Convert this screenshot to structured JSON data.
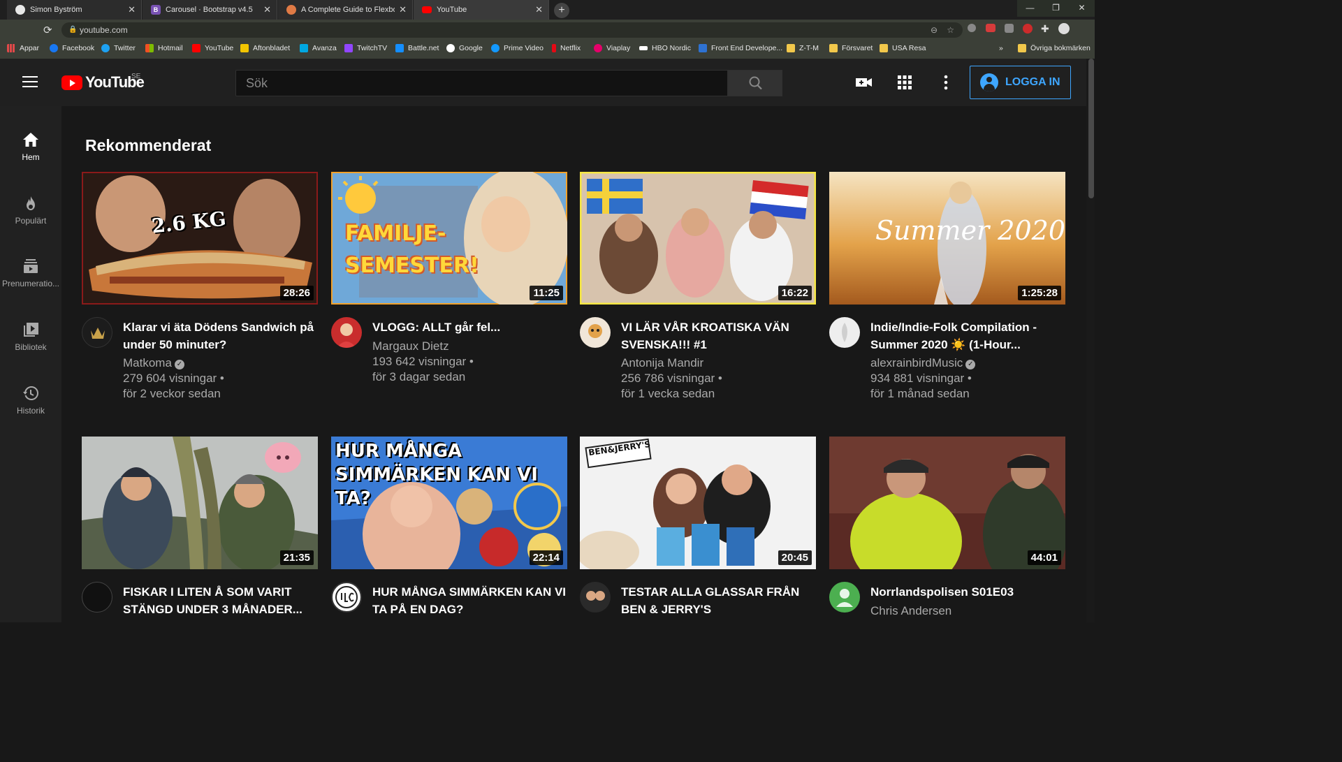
{
  "browser": {
    "tabs": [
      {
        "label": "Simon Byström",
        "icon_color": "#e8e8e8"
      },
      {
        "label": "Carousel · Bootstrap v4.5",
        "icon_color": "#7952b3",
        "icon_letter": "B"
      },
      {
        "label": "A Complete Guide to Flexbox | C",
        "icon_color": "#e07a45"
      },
      {
        "label": "YouTube",
        "icon_color": "#ff0000"
      }
    ],
    "new_tab": "+",
    "url": "youtube.com",
    "bookmarks": [
      {
        "label": "Appar",
        "color": "#e14949"
      },
      {
        "label": "Facebook",
        "color": "#1877f2"
      },
      {
        "label": "Twitter",
        "color": "#1da1f2"
      },
      {
        "label": "Hotmail",
        "color": "#f25022"
      },
      {
        "label": "YouTube",
        "color": "#ff0000"
      },
      {
        "label": "Aftonbladet",
        "color": "#f2c500"
      },
      {
        "label": "Avanza",
        "color": "#00a7e1"
      },
      {
        "label": "TwitchTV",
        "color": "#9146ff"
      },
      {
        "label": "Battle.net",
        "color": "#148eff"
      },
      {
        "label": "Google",
        "color": "#ffffff"
      },
      {
        "label": "Prime Video",
        "color": "#1399ff"
      },
      {
        "label": "Netflix",
        "color": "#e50914"
      },
      {
        "label": "Viaplay",
        "color": "#e5006a"
      },
      {
        "label": "HBO Nordic",
        "color": "#ffffff"
      },
      {
        "label": "Front End Develope...",
        "color": "#2e72d2"
      },
      {
        "label": "Z-T-M",
        "color": "#f2c84b"
      },
      {
        "label": "Försvaret",
        "color": "#f2c84b"
      },
      {
        "label": "USA Resa",
        "color": "#f2c84b"
      }
    ],
    "bookmarks_more": "»",
    "other_bookmarks": "Övriga bokmärken"
  },
  "youtube": {
    "logo_text": "YouTube",
    "country": "SE",
    "search_placeholder": "Sök",
    "sign_in": "LOGGA IN",
    "accent": "#3ea6ff",
    "sidebar": [
      {
        "label": "Hem",
        "icon": "home-icon"
      },
      {
        "label": "Populärt",
        "icon": "flame-icon"
      },
      {
        "label": "Prenumeratio...",
        "icon": "subscriptions-icon"
      },
      {
        "label": "Bibliotek",
        "icon": "library-icon"
      },
      {
        "label": "Historik",
        "icon": "history-icon"
      }
    ],
    "section_title": "Rekommenderat",
    "videos": [
      {
        "title": "Klarar vi äta Dödens Sandwich på under 50 minuter?",
        "channel": "Matkoma",
        "verified": true,
        "views": "279 604 visningar •",
        "age": "för 2 veckor sedan",
        "duration": "28:26",
        "thumb_text": "2.6 KG"
      },
      {
        "title": "VLOGG: ALLT går fel...",
        "channel": "Margaux Dietz",
        "verified": false,
        "views": "193 642 visningar •",
        "age": "för 3 dagar sedan",
        "duration": "11:25",
        "thumb_text": "FAMILJE-SEMESTER!"
      },
      {
        "title": "VI LÄR VÅR KROATISKA VÄN SVENSKA!!! #1",
        "channel": "Antonija Mandir",
        "verified": false,
        "views": "256 786 visningar •",
        "age": "för 1 vecka sedan",
        "duration": "16:22",
        "thumb_text": ""
      },
      {
        "title": "Indie/Indie-Folk Compilation - Summer 2020 ☀️ (1-Hour...",
        "channel": "alexrainbirdMusic",
        "verified": true,
        "views": "934 881 visningar •",
        "age": "för 1 månad sedan",
        "duration": "1:25:28",
        "thumb_text": "Summer 2020"
      },
      {
        "title": "FISKAR I LITEN Å SOM VARIT STÄNGD UNDER 3 MÅNADER...",
        "channel": "",
        "verified": false,
        "views": "",
        "age": "",
        "duration": "21:35",
        "thumb_text": ""
      },
      {
        "title": "HUR MÅNGA SIMMÄRKEN KAN VI TA PÅ EN DAG?",
        "channel": "",
        "verified": false,
        "views": "",
        "age": "",
        "duration": "22:14",
        "thumb_text": "HUR MÅNGA SIMMÄRKEN KAN VI TA?"
      },
      {
        "title": "TESTAR ALLA GLASSAR FRÅN BEN & JERRY'S",
        "channel": "",
        "verified": false,
        "views": "",
        "age": "",
        "duration": "20:45",
        "thumb_text": "BEN&JERRY'S"
      },
      {
        "title": "Norrlandspolisen S01E03",
        "channel": "Chris Andersen",
        "verified": false,
        "views": "",
        "age": "",
        "duration": "44:01",
        "thumb_text": ""
      }
    ]
  }
}
